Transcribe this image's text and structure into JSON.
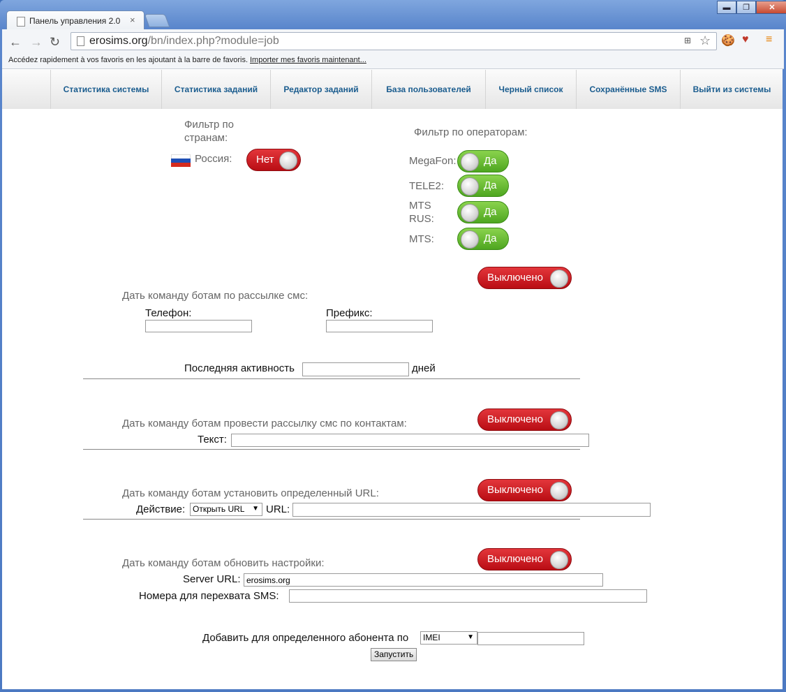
{
  "browser": {
    "tab_title": "Панель управления 2.0",
    "tab_close": "×",
    "window_buttons": [
      "▬",
      "❐",
      "✕"
    ],
    "url_domain": "erosims.org",
    "url_path": "/bn/index.php?module=job",
    "bookmarks_msg": "Accédez rapidement à vos favoris en les ajoutant à la barre de favoris.",
    "bookmarks_link": "Importer mes favoris maintenant..."
  },
  "menu": [
    "Статистика системы",
    "Статистика заданий",
    "Редактор заданий",
    "База пользователей",
    "Черный список",
    "Сохранённые SMS",
    "Выйти из системы"
  ],
  "country_filter": {
    "label_line1": "Фильтр по",
    "label_line2": "странам:",
    "country": "Россия:",
    "toggle": "Нет"
  },
  "operator_filter": {
    "label": "Фильтр по операторам:",
    "operators": [
      {
        "name": "MegaFon:",
        "toggle": "Да"
      },
      {
        "name": "TELE2:",
        "toggle": "Да"
      },
      {
        "name_line1": "MTS",
        "name_line2": "RUS:",
        "toggle": "Да"
      },
      {
        "name": "MTS:",
        "toggle": "Да"
      }
    ]
  },
  "sms_send": {
    "toggle": "Выключено",
    "title": "Дать команду ботам по рассылке смс:",
    "phone_label": "Телефон:",
    "prefix_label": "Префикс:",
    "activity_label": "Последняя активность",
    "days_label": "дней"
  },
  "contacts_send": {
    "title": "Дать команду ботам провести рассылку смс по контактам:",
    "toggle": "Выключено",
    "text_label": "Текст:"
  },
  "url_cmd": {
    "title": "Дать команду ботам установить определенный URL:",
    "toggle": "Выключено",
    "action_label": "Действие:",
    "action_value": "Открыть URL",
    "url_label": "URL:"
  },
  "settings_cmd": {
    "title": "Дать команду ботам обновить настройки:",
    "toggle": "Выключено",
    "server_label": "Server URL:",
    "server_value": "erosims.org",
    "intercept_label": "Номера для перехвата SMS:"
  },
  "subscriber": {
    "label": "Добавить для определенного абонента по",
    "select_value": "IMEI",
    "run_button": "Запустить"
  },
  "colors": {
    "toggle_on": "#5fb52a",
    "toggle_off": "#c8141b",
    "menu_link": "#1a5c8e"
  }
}
